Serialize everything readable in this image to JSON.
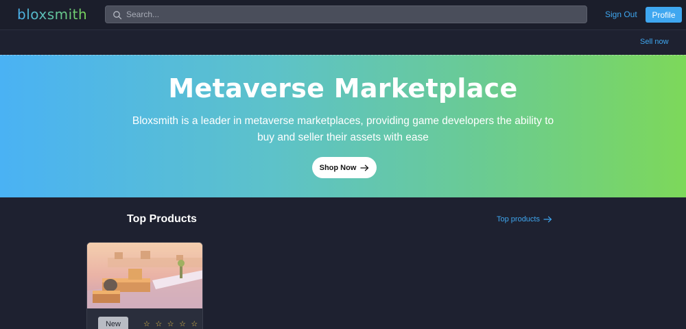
{
  "header": {
    "logo": "bloxsmith",
    "search_placeholder": "Search...",
    "sign_out_label": "Sign Out",
    "profile_label": "Profile"
  },
  "subnav": {
    "sell_now_label": "Sell now"
  },
  "hero": {
    "title": "Metaverse Marketplace",
    "subtitle": "Bloxsmith is a leader in metaverse marketplaces, providing game developers the ability to buy and seller their assets with ease",
    "cta_label": "Shop Now"
  },
  "top_products": {
    "title": "Top Products",
    "link_label": "Top products",
    "products": [
      {
        "badge": "New",
        "rating_stars": "☆ ☆ ☆ ☆ ☆",
        "rating": 0,
        "rating_max": 5
      }
    ]
  },
  "colors": {
    "accent": "#3fa7f0",
    "background": "#1e2130",
    "hero_gradient_start": "#4ab2f4",
    "hero_gradient_end": "#7dd85a"
  }
}
